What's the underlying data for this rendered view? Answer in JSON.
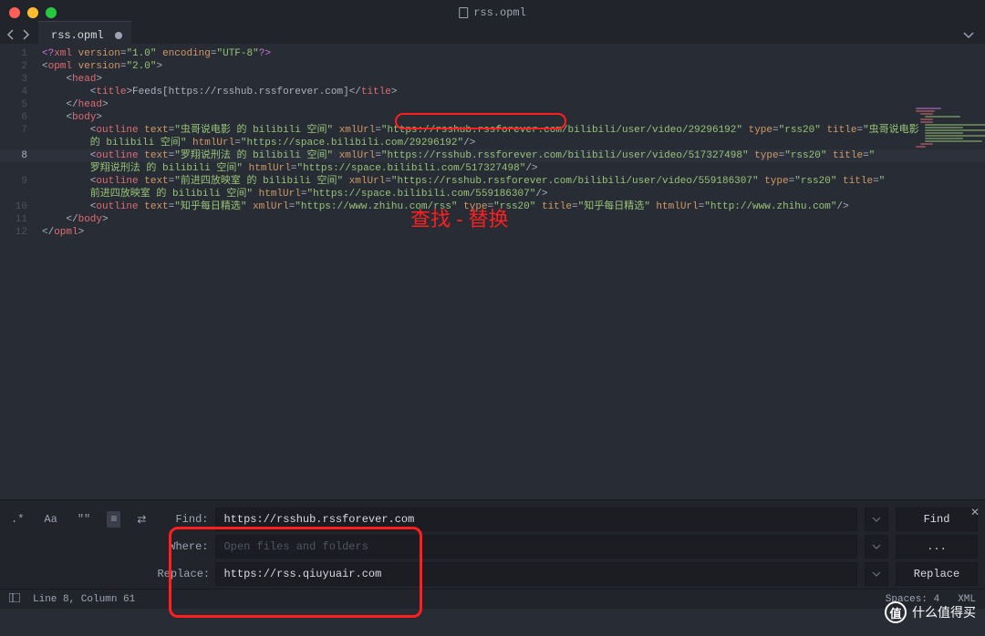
{
  "window": {
    "title": "rss.opml"
  },
  "tab": {
    "name": "rss.opml",
    "modified": true
  },
  "gutter": {
    "highlighted_line": 8
  },
  "code": {
    "lines": [
      [
        {
          "c": "tok-meta",
          "t": "<?"
        },
        {
          "c": "tok-tag",
          "t": "xml"
        },
        {
          "c": "tok-punc",
          "t": " "
        },
        {
          "c": "tok-attr",
          "t": "version"
        },
        {
          "c": "tok-punc",
          "t": "="
        },
        {
          "c": "tok-str",
          "t": "\"1.0\""
        },
        {
          "c": "tok-punc",
          "t": " "
        },
        {
          "c": "tok-attr",
          "t": "encoding"
        },
        {
          "c": "tok-punc",
          "t": "="
        },
        {
          "c": "tok-str",
          "t": "\"UTF-8\""
        },
        {
          "c": "tok-meta",
          "t": "?>"
        }
      ],
      [
        {
          "c": "tok-punc",
          "t": "<"
        },
        {
          "c": "tok-tag",
          "t": "opml"
        },
        {
          "c": "tok-punc",
          "t": " "
        },
        {
          "c": "tok-attr",
          "t": "version"
        },
        {
          "c": "tok-punc",
          "t": "="
        },
        {
          "c": "tok-str",
          "t": "\"2.0\""
        },
        {
          "c": "tok-punc",
          "t": ">"
        }
      ],
      [
        {
          "c": "tok-punc",
          "t": "    <"
        },
        {
          "c": "tok-tag",
          "t": "head"
        },
        {
          "c": "tok-punc",
          "t": ">"
        }
      ],
      [
        {
          "c": "tok-punc",
          "t": "        <"
        },
        {
          "c": "tok-tag",
          "t": "title"
        },
        {
          "c": "tok-punc",
          "t": ">"
        },
        {
          "c": "tok-text",
          "t": "Feeds[https://rsshub.rssforever.com]"
        },
        {
          "c": "tok-punc",
          "t": "</"
        },
        {
          "c": "tok-tag",
          "t": "title"
        },
        {
          "c": "tok-punc",
          "t": ">"
        }
      ],
      [
        {
          "c": "tok-punc",
          "t": "    </"
        },
        {
          "c": "tok-tag",
          "t": "head"
        },
        {
          "c": "tok-punc",
          "t": ">"
        }
      ],
      [
        {
          "c": "tok-punc",
          "t": "    <"
        },
        {
          "c": "tok-tag",
          "t": "body"
        },
        {
          "c": "tok-punc",
          "t": ">"
        }
      ],
      [
        {
          "c": "tok-punc",
          "t": "        <"
        },
        {
          "c": "tok-tag",
          "t": "outline"
        },
        {
          "c": "tok-punc",
          "t": " "
        },
        {
          "c": "tok-attr",
          "t": "text"
        },
        {
          "c": "tok-punc",
          "t": "="
        },
        {
          "c": "tok-str",
          "t": "\"虫哥说电影 的 bilibili 空间\""
        },
        {
          "c": "tok-punc",
          "t": " "
        },
        {
          "c": "tok-attr",
          "t": "xmlUrl"
        },
        {
          "c": "tok-punc",
          "t": "="
        },
        {
          "c": "tok-str",
          "t": "\"https://rsshub.rssforever.com/bilibili/user/video/29296192\""
        },
        {
          "c": "tok-punc",
          "t": " "
        },
        {
          "c": "tok-attr",
          "t": "type"
        },
        {
          "c": "tok-punc",
          "t": "="
        },
        {
          "c": "tok-str",
          "t": "\"rss20\""
        },
        {
          "c": "tok-punc",
          "t": " "
        },
        {
          "c": "tok-attr",
          "t": "title"
        },
        {
          "c": "tok-punc",
          "t": "="
        },
        {
          "c": "tok-str",
          "t": "\"虫哥说电影"
        }
      ],
      [
        {
          "c": "tok-str",
          "t": "        的 bilibili 空间\""
        },
        {
          "c": "tok-punc",
          "t": " "
        },
        {
          "c": "tok-attr",
          "t": "htmlUrl"
        },
        {
          "c": "tok-punc",
          "t": "="
        },
        {
          "c": "tok-str",
          "t": "\"https://space.bilibili.com/29296192\""
        },
        {
          "c": "tok-punc",
          "t": "/>"
        }
      ],
      [
        {
          "c": "tok-punc",
          "t": "        <"
        },
        {
          "c": "tok-tag",
          "t": "outline"
        },
        {
          "c": "tok-punc",
          "t": " "
        },
        {
          "c": "tok-attr",
          "t": "text"
        },
        {
          "c": "tok-punc",
          "t": "="
        },
        {
          "c": "tok-str",
          "t": "\"罗翔说刑法 的 bilibili 空间\""
        },
        {
          "c": "tok-punc",
          "t": " "
        },
        {
          "c": "tok-attr",
          "t": "xmlUrl"
        },
        {
          "c": "tok-punc",
          "t": "="
        },
        {
          "c": "tok-str",
          "t": "\"https://rsshub.rssforever.com/bilibili/user/video/517327498\""
        },
        {
          "c": "tok-punc",
          "t": " "
        },
        {
          "c": "tok-attr",
          "t": "type"
        },
        {
          "c": "tok-punc",
          "t": "="
        },
        {
          "c": "tok-str",
          "t": "\"rss20\""
        },
        {
          "c": "tok-punc",
          "t": " "
        },
        {
          "c": "tok-attr",
          "t": "title"
        },
        {
          "c": "tok-punc",
          "t": "="
        },
        {
          "c": "tok-str",
          "t": "\""
        }
      ],
      [
        {
          "c": "tok-str",
          "t": "        罗翔说刑法 的 bilibili 空间\""
        },
        {
          "c": "tok-punc",
          "t": " "
        },
        {
          "c": "tok-attr",
          "t": "htmlUrl"
        },
        {
          "c": "tok-punc",
          "t": "="
        },
        {
          "c": "tok-str",
          "t": "\"https://space.bilibili.com/517327498\""
        },
        {
          "c": "tok-punc",
          "t": "/>"
        }
      ],
      [
        {
          "c": "tok-punc",
          "t": "        <"
        },
        {
          "c": "tok-tag",
          "t": "outline"
        },
        {
          "c": "tok-punc",
          "t": " "
        },
        {
          "c": "tok-attr",
          "t": "text"
        },
        {
          "c": "tok-punc",
          "t": "="
        },
        {
          "c": "tok-str",
          "t": "\"前进四放映室 的 bilibili 空间\""
        },
        {
          "c": "tok-punc",
          "t": " "
        },
        {
          "c": "tok-attr",
          "t": "xmlUrl"
        },
        {
          "c": "tok-punc",
          "t": "="
        },
        {
          "c": "tok-str",
          "t": "\"https://rsshub.rssforever.com/bilibili/user/video/559186307\""
        },
        {
          "c": "tok-punc",
          "t": " "
        },
        {
          "c": "tok-attr",
          "t": "type"
        },
        {
          "c": "tok-punc",
          "t": "="
        },
        {
          "c": "tok-str",
          "t": "\"rss20\""
        },
        {
          "c": "tok-punc",
          "t": " "
        },
        {
          "c": "tok-attr",
          "t": "title"
        },
        {
          "c": "tok-punc",
          "t": "="
        },
        {
          "c": "tok-str",
          "t": "\""
        }
      ],
      [
        {
          "c": "tok-str",
          "t": "        前进四放映室 的 bilibili 空间\""
        },
        {
          "c": "tok-punc",
          "t": " "
        },
        {
          "c": "tok-attr",
          "t": "htmlUrl"
        },
        {
          "c": "tok-punc",
          "t": "="
        },
        {
          "c": "tok-str",
          "t": "\"https://space.bilibili.com/559186307\""
        },
        {
          "c": "tok-punc",
          "t": "/>"
        }
      ],
      [
        {
          "c": "tok-punc",
          "t": "        <"
        },
        {
          "c": "tok-tag",
          "t": "outline"
        },
        {
          "c": "tok-punc",
          "t": " "
        },
        {
          "c": "tok-attr",
          "t": "text"
        },
        {
          "c": "tok-punc",
          "t": "="
        },
        {
          "c": "tok-str",
          "t": "\"知乎每日精选\""
        },
        {
          "c": "tok-punc",
          "t": " "
        },
        {
          "c": "tok-attr",
          "t": "xmlUrl"
        },
        {
          "c": "tok-punc",
          "t": "="
        },
        {
          "c": "tok-str",
          "t": "\"https://www.zhihu.com/rss\""
        },
        {
          "c": "tok-punc",
          "t": " "
        },
        {
          "c": "tok-attr",
          "t": "type"
        },
        {
          "c": "tok-punc",
          "t": "="
        },
        {
          "c": "tok-str",
          "t": "\"rss20\""
        },
        {
          "c": "tok-punc",
          "t": " "
        },
        {
          "c": "tok-attr",
          "t": "title"
        },
        {
          "c": "tok-punc",
          "t": "="
        },
        {
          "c": "tok-str",
          "t": "\"知乎每日精选\""
        },
        {
          "c": "tok-punc",
          "t": " "
        },
        {
          "c": "tok-attr",
          "t": "htmlUrl"
        },
        {
          "c": "tok-punc",
          "t": "="
        },
        {
          "c": "tok-str",
          "t": "\"http://www.zhihu.com\""
        },
        {
          "c": "tok-punc",
          "t": "/>"
        }
      ],
      [
        {
          "c": "tok-punc",
          "t": "    </"
        },
        {
          "c": "tok-tag",
          "t": "body"
        },
        {
          "c": "tok-punc",
          "t": ">"
        }
      ],
      [
        {
          "c": "tok-punc",
          "t": "</"
        },
        {
          "c": "tok-tag",
          "t": "opml"
        },
        {
          "c": "tok-punc",
          "t": ">"
        }
      ]
    ],
    "visual_line_numbers": [
      "1",
      "2",
      "3",
      "4",
      "5",
      "6",
      "7",
      "",
      "8",
      "",
      "9",
      "",
      "10",
      "11",
      "12"
    ]
  },
  "annotation": {
    "text": "查找 - 替换"
  },
  "find": {
    "labels": {
      "find": "Find:",
      "where": "Where:",
      "replace": "Replace:"
    },
    "find_value": "https://rsshub.rssforever.com",
    "where_placeholder": "Open files and folders",
    "replace_value": "https://rss.qiuyuair.com",
    "buttons": {
      "find": "Find",
      "where": "...",
      "replace": "Replace"
    },
    "toggles": {
      "regex": ".*",
      "case": "Aa",
      "word": "\"\"",
      "wrap": "≡",
      "sel": "⇄"
    }
  },
  "status": {
    "cursor": "Line 8, Column 61",
    "spaces": "Spaces: 4",
    "syntax": "XML"
  },
  "watermark": {
    "text": "什么值得买",
    "badge": "值"
  }
}
